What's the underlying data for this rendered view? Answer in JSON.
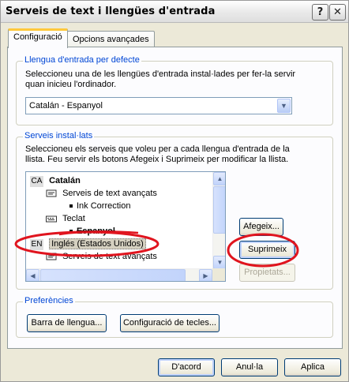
{
  "window": {
    "title": "Serveis de text i llengües d'entrada",
    "help_button": "?",
    "close_button": "✕"
  },
  "tabs": [
    {
      "label": "Configuració",
      "active": true
    },
    {
      "label": "Opcions avançades",
      "active": false
    }
  ],
  "default_language": {
    "legend": "Llengua d'entrada per defecte",
    "description_line1": "Seleccioneu una de les llengües d'entrada instal·lades per fer-la servir",
    "description_line2": "quan inicieu l'ordinador.",
    "selected_value": "Catalán - Espanyol"
  },
  "installed_services": {
    "legend": "Serveis instal·lats",
    "description_line1": "Seleccioneu els serveis que voleu per a cada llengua d'entrada de la",
    "description_line2": "llista. Feu servir els botons Afegeix i Suprimeix per modificar la llista.",
    "tree": {
      "lang1_code": "CA",
      "lang1_name": "Catalán",
      "lang1_adv_services": "Serveis de text avançats",
      "lang1_ink": "Ink Correction",
      "lang1_keyboard": "Teclat",
      "lang1_keyboard_item": "Espanyol",
      "lang2_code": "EN",
      "lang2_name": "Inglés (Estados Unidos)",
      "lang2_adv_services": "Serveis de text avançats"
    },
    "buttons": {
      "add": "Afegeix...",
      "remove": "Suprimeix",
      "properties": "Propietats..."
    }
  },
  "preferences": {
    "legend": "Preferències",
    "language_bar_button": "Barra de llengua...",
    "key_settings_button": "Configuració de tecles..."
  },
  "footer": {
    "ok": "D'acord",
    "cancel": "Anul·la",
    "apply": "Aplica"
  },
  "colors": {
    "dialog_bg": "#ECE9D8",
    "group_title": "#0046D5",
    "annotation_red": "#E0141E",
    "tab_highlight": "#FFC83C"
  }
}
